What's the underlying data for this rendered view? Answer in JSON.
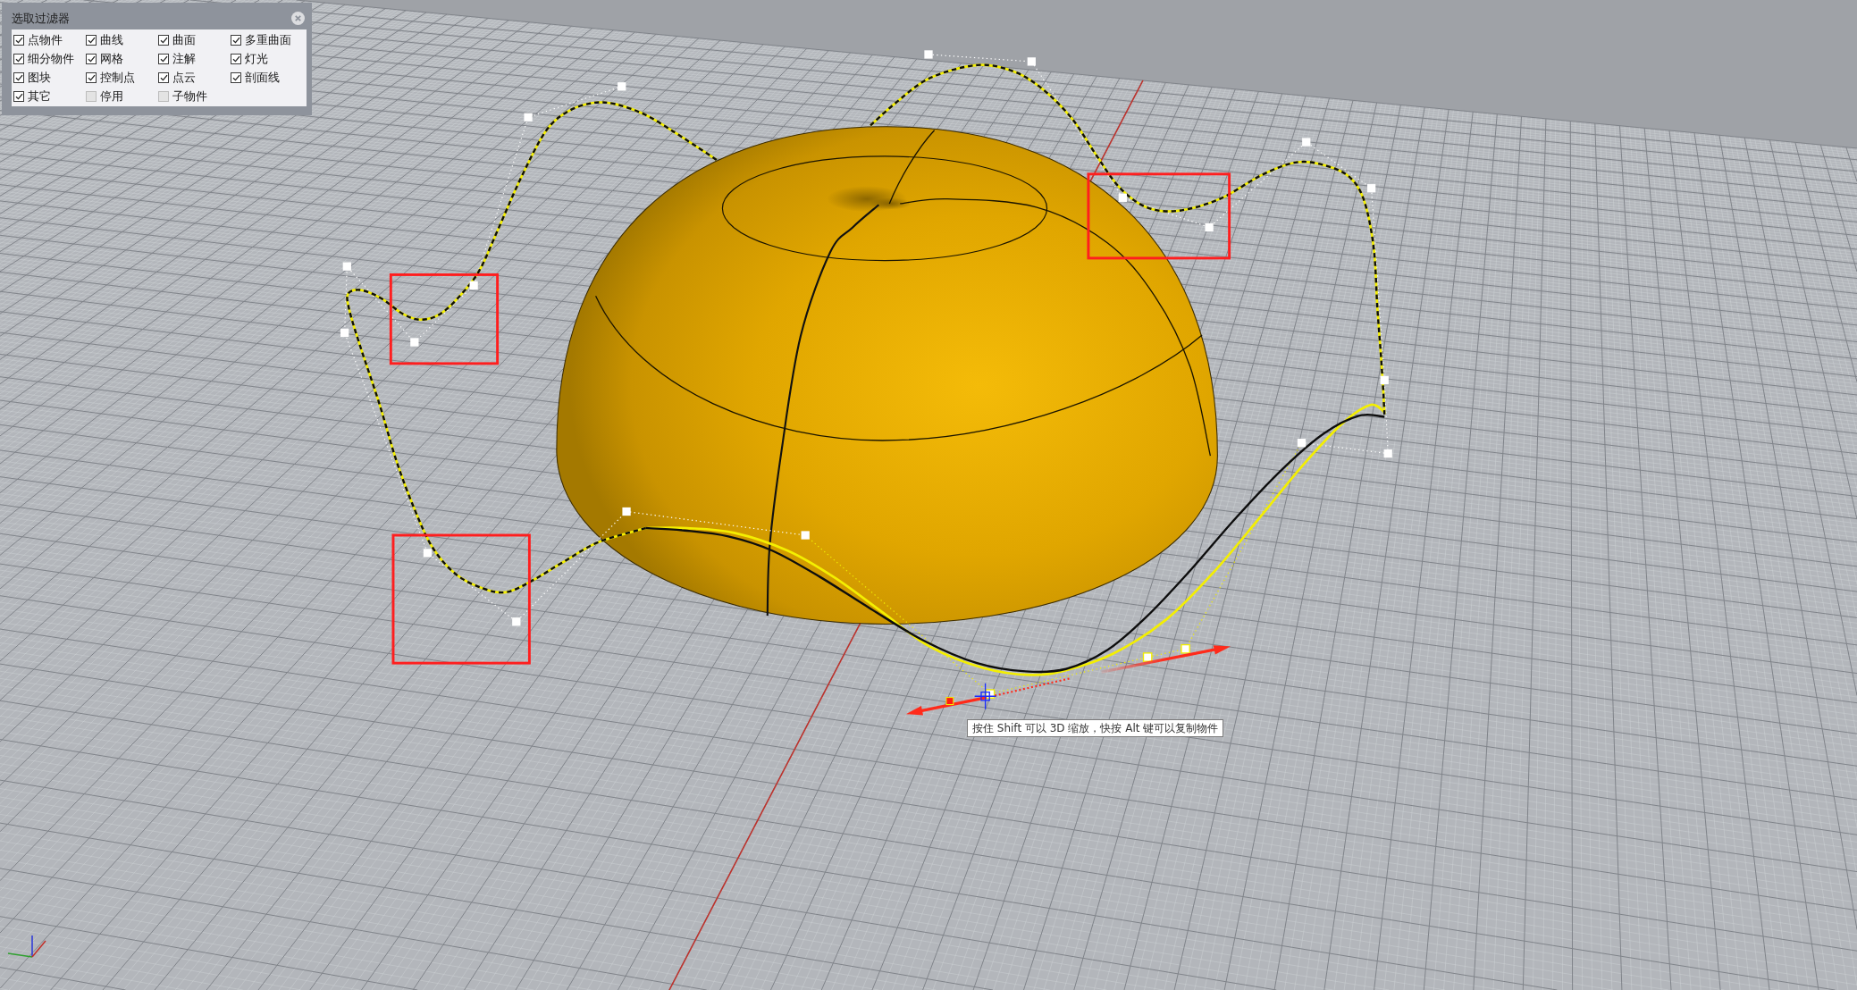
{
  "selection_filter": {
    "title": "选取过滤器",
    "options": [
      {
        "label": "点物件",
        "checked": true
      },
      {
        "label": "曲线",
        "checked": true
      },
      {
        "label": "曲面",
        "checked": true
      },
      {
        "label": "多重曲面",
        "checked": true
      },
      {
        "label": "细分物件",
        "checked": true
      },
      {
        "label": "网格",
        "checked": true
      },
      {
        "label": "注解",
        "checked": true
      },
      {
        "label": "灯光",
        "checked": true
      },
      {
        "label": "图块",
        "checked": true
      },
      {
        "label": "控制点",
        "checked": true
      },
      {
        "label": "点云",
        "checked": true
      },
      {
        "label": "剖面线",
        "checked": true
      },
      {
        "label": "其它",
        "checked": true
      },
      {
        "label": "停用",
        "checked": false
      },
      {
        "label": "子物件",
        "checked": false
      }
    ]
  },
  "tooltip": {
    "text": "按住 Shift 可以 3D 缩放，快按 Alt 键可以复制物件"
  }
}
